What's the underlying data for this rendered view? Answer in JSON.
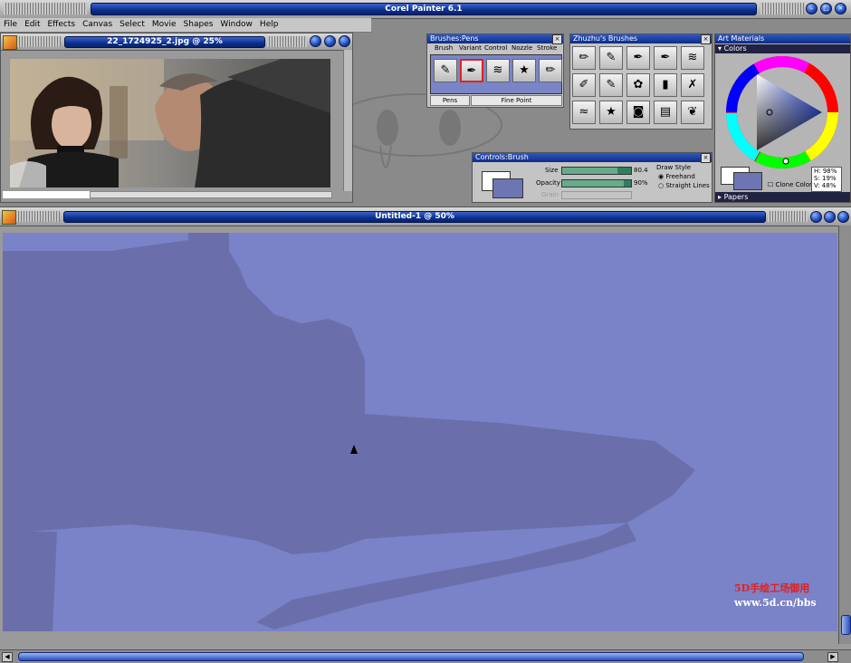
{
  "app": {
    "title": "Corel Painter 6.1"
  },
  "menu": [
    "File",
    "Edit",
    "Effects",
    "Canvas",
    "Select",
    "Movie",
    "Shapes",
    "Window",
    "Help"
  ],
  "photo_window": {
    "title": "22_1724925_2.jpg @ 25%"
  },
  "canvas_window": {
    "title": "Untitled-1 @ 50%"
  },
  "brushes_panel": {
    "title": "Brushes:Pens",
    "tabs": [
      "Brush",
      "Variant",
      "Control",
      "Nozzle",
      "Stroke"
    ],
    "brush_name": "Pens",
    "variant_name": "Fine Point"
  },
  "zhuzhu_panel": {
    "title": "Zhuzhu's Brushes"
  },
  "controls_panel": {
    "title": "Controls:Brush",
    "size_label": "Size",
    "size_value": "80.4",
    "size_level": 0.8,
    "opacity_label": "Opacity",
    "opacity_value": "90%",
    "opacity_level": 0.9,
    "grain_label": "Grain",
    "draw_style_label": "Draw Style",
    "freehand": "Freehand",
    "straight": "Straight Lines"
  },
  "art_materials": {
    "title": "Art Materials",
    "colors_label": "Colors",
    "clone_color": "Clone Color",
    "h": "H: 98%",
    "s": "S: 19%",
    "v": "V: 48%",
    "papers_label": "Papers"
  },
  "watermark": {
    "line1": "5D手绘工场御用",
    "line2": "www.5d.cn/bbs"
  },
  "colors": {
    "canvas": "#7a82c8",
    "shadow": "#6a6fab",
    "secondary": "#6e75b3"
  }
}
